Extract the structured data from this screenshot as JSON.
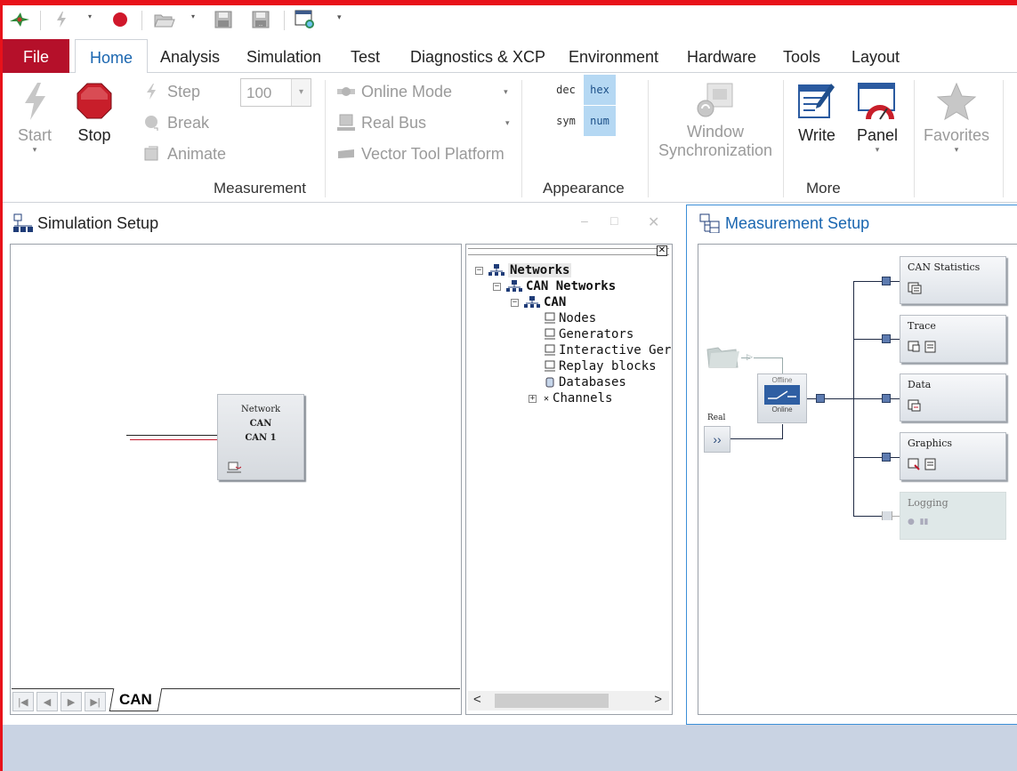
{
  "ribbon_tabs": [
    "File",
    "Home",
    "Analysis",
    "Simulation",
    "Test",
    "Diagnostics & XCP",
    "Environment",
    "Hardware",
    "Tools",
    "Layout"
  ],
  "home": {
    "start_label": "Start",
    "stop_label": "Stop",
    "step_label": "Step",
    "break_label": "Break",
    "animate_label": "Animate",
    "step_value": "100",
    "online_mode_label": "Online Mode",
    "real_bus_label": "Real Bus",
    "vector_tool_platform_label": "Vector Tool Platform",
    "group_measurement": "Measurement",
    "fmt_dec": "dec",
    "fmt_hex": "hex",
    "fmt_sym": "sym",
    "fmt_num": "num",
    "group_appearance": "Appearance",
    "window_sync_line1": "Window",
    "window_sync_line2": "Synchronization",
    "write_label": "Write",
    "panel_label": "Panel",
    "favorites_label": "Favorites",
    "group_more": "More"
  },
  "simulation_setup": {
    "title": "Simulation Setup",
    "network_block": {
      "line1": "Network",
      "line2": "CAN",
      "line3": "CAN 1"
    },
    "bottom_tab": "CAN",
    "tree": [
      "Networks",
      "CAN Networks",
      "CAN",
      "Nodes",
      "Generators",
      "Interactive Ger",
      "Replay blocks",
      "Databases",
      "Channels"
    ]
  },
  "measurement_setup": {
    "title": "Measurement Setup",
    "offline_label": "Offline",
    "online_label": "Online",
    "real_label": "Real",
    "blocks": [
      "CAN Statistics",
      "Trace",
      "Data",
      "Graphics",
      "Logging"
    ]
  },
  "colors": {
    "frame_red": "#e8121a",
    "file_tab": "#b5102a",
    "accent_blue": "#1a66b0",
    "status_bar": "#c9d3e3"
  }
}
